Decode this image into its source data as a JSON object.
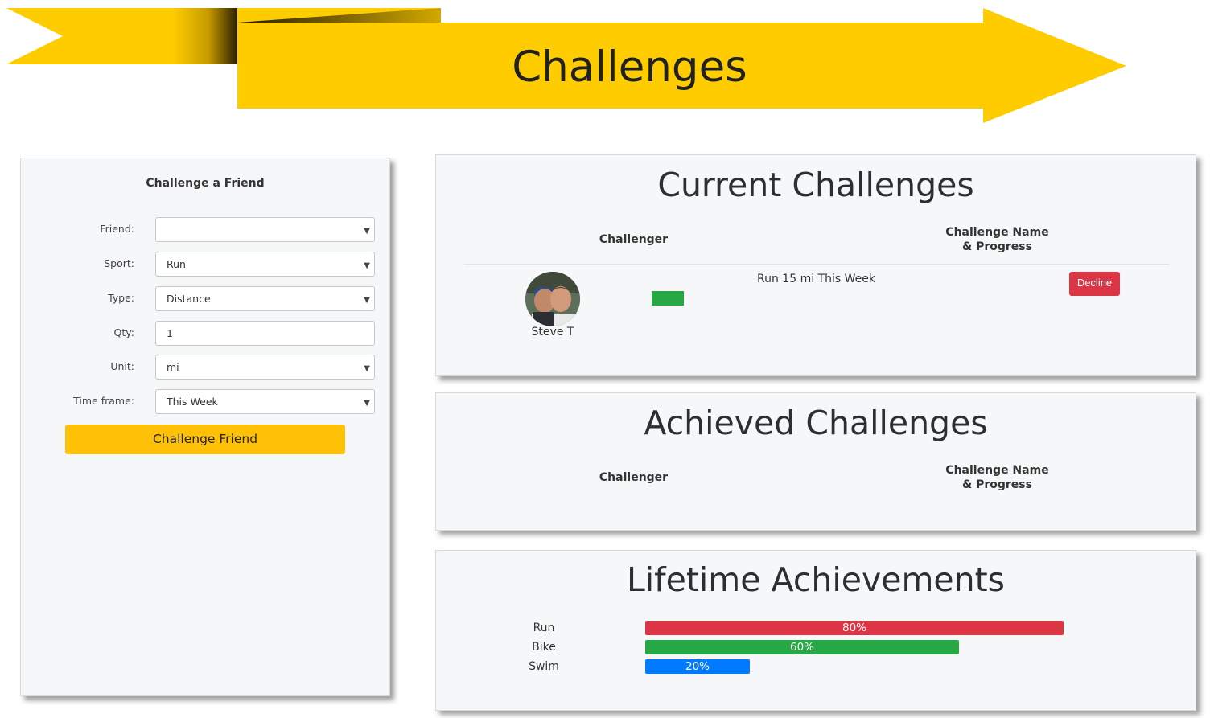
{
  "header": {
    "title": "Challenges"
  },
  "challenge_form": {
    "title": "Challenge a Friend",
    "fields": [
      {
        "label": "Friend:",
        "value": "",
        "type": "select"
      },
      {
        "label": "Sport:",
        "value": "Run",
        "type": "select"
      },
      {
        "label": "Type:",
        "value": "Distance",
        "type": "select"
      },
      {
        "label": "Qty:",
        "value": "1",
        "type": "input"
      },
      {
        "label": "Unit:",
        "value": "mi",
        "type": "select"
      },
      {
        "label": "Time frame:",
        "value": "This Week",
        "type": "select"
      }
    ],
    "submit_label": "Challenge Friend"
  },
  "current_challenges": {
    "title": "Current Challenges",
    "col_challenger": "Challenger",
    "col_name_line1": "Challenge Name",
    "col_name_line2": "& Progress",
    "rows": [
      {
        "challenger": "Steve T",
        "challenge": "Run 15 mi This Week",
        "decline_label": "Decline",
        "progress_color": "#28a745"
      }
    ]
  },
  "achieved_challenges": {
    "title": "Achieved Challenges",
    "col_challenger": "Challenger",
    "col_name_line1": "Challenge Name",
    "col_name_line2": "& Progress"
  },
  "lifetime_achievements": {
    "title": "Lifetime Achievements",
    "bars": [
      {
        "label": "Run",
        "percent": 80,
        "text": "80%",
        "color": "#dc3545"
      },
      {
        "label": "Bike",
        "percent": 60,
        "text": "60%",
        "color": "#28a745"
      },
      {
        "label": "Swim",
        "percent": 20,
        "text": "20%",
        "color": "#007bff"
      }
    ]
  },
  "colors": {
    "banner": "#ffcc00",
    "accent_button": "#ffc107",
    "danger": "#dc3545",
    "card_bg": "#f5f7f8"
  }
}
